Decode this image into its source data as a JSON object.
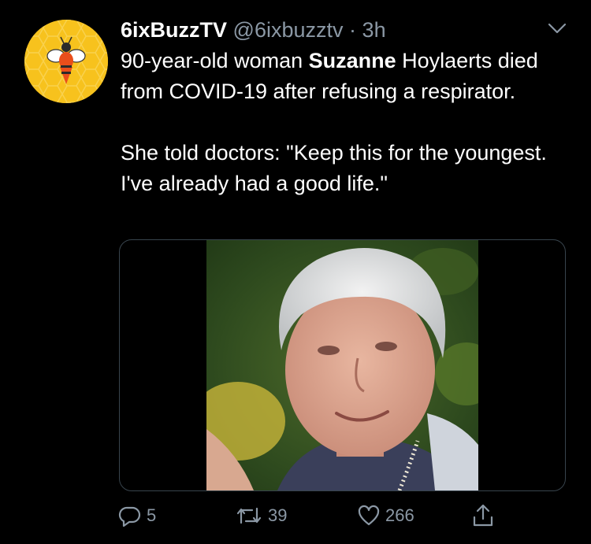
{
  "colors": {
    "background": "#000000",
    "text": "#ffffff",
    "secondary": "#8b98a5",
    "avatar_bg": "#f7c21d"
  },
  "tweet": {
    "author_name": "6ixBuzzTV",
    "handle": "@6ixbuzztv",
    "separator": "·",
    "time": "3h",
    "text_line1_pre": "90-year-old woman ",
    "text_line1_bold": "Suzanne",
    "text_line1_post": " Hoylaerts died from COVID-19 after refusing a respirator.",
    "text_para2": "She told doctors: \"Keep this for the youngest. I've already had a good life.\""
  },
  "icons": {
    "avatar": "bee-logo-icon",
    "menu": "chevron-down-icon",
    "reply": "reply-icon",
    "retweet": "retweet-icon",
    "like": "heart-icon",
    "share": "share-icon"
  },
  "actions": {
    "reply_count": "5",
    "retweet_count": "39",
    "like_count": "266"
  }
}
